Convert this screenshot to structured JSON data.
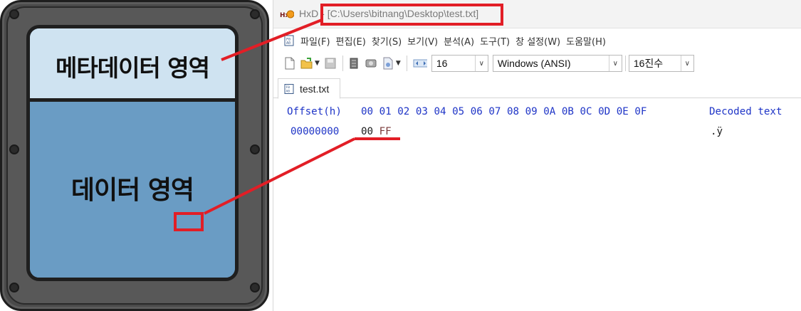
{
  "diagram": {
    "metadata_region_label": "메타데이터 영역",
    "data_region_label": "데이터 영역"
  },
  "window": {
    "app_name": "HxD",
    "title_separator": " - ",
    "file_path": "[C:\\Users\\bitnang\\Desktop\\test.txt]"
  },
  "menu": {
    "items": [
      "파일(F)",
      "편집(E)",
      "찾기(S)",
      "보기(V)",
      "분석(A)",
      "도구(T)",
      "창 설정(W)",
      "도움말(H)"
    ]
  },
  "toolbar": {
    "bytes_per_row": "16",
    "charset": "Windows (ANSI)",
    "offset_base": "16진수"
  },
  "tab": {
    "label": "test.txt"
  },
  "hex_view": {
    "offset_header": "Offset(h)",
    "column_headers": "00 01 02 03 04 05 06 07 08 09 0A 0B 0C 0D 0E 0F",
    "decoded_header": "Decoded text",
    "rows": [
      {
        "offset": "00000000",
        "byte1": "00",
        "byte2": "FF",
        "decoded": ".ÿ"
      }
    ]
  },
  "colors": {
    "highlight_red": "#e21e26",
    "metadata_region": "#cfe3f1",
    "data_region": "#6a9cc4",
    "hex_header_blue": "#1f35c7"
  }
}
